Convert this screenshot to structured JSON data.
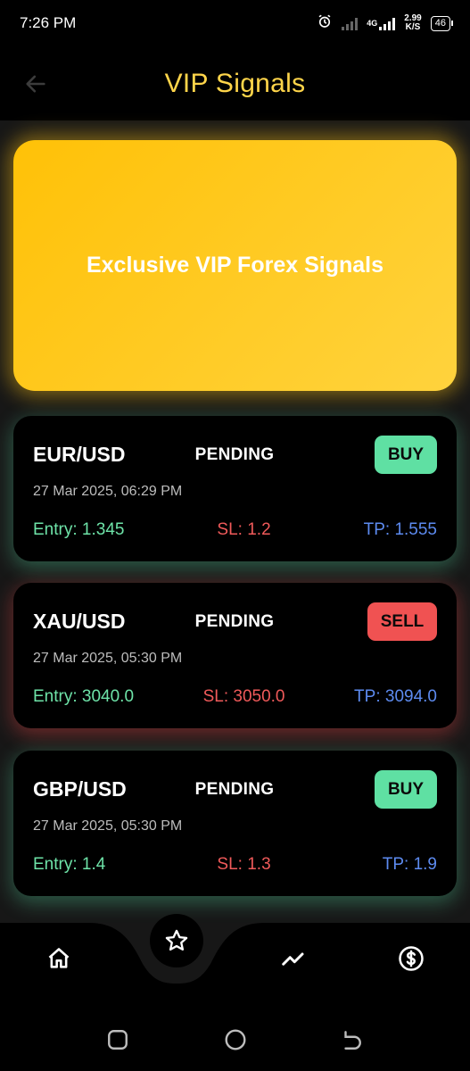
{
  "status_bar": {
    "time": "7:26 PM",
    "network": "4G",
    "speed_value": "2.99",
    "speed_unit": "K/S",
    "battery": "46"
  },
  "app_bar": {
    "title": "VIP Signals",
    "back_icon": "arrow-left-icon"
  },
  "banner": {
    "text": "Exclusive VIP Forex Signals",
    "color": "#ffc107"
  },
  "signals": [
    {
      "pair": "EUR/USD",
      "status": "PENDING",
      "action": "BUY",
      "time": "27 Mar 2025, 06:29 PM",
      "entry": "Entry: 1.345",
      "sl": "SL: 1.2",
      "tp": "TP: 1.555"
    },
    {
      "pair": "XAU/USD",
      "status": "PENDING",
      "action": "SELL",
      "time": "27 Mar 2025, 05:30 PM",
      "entry": "Entry: 3040.0",
      "sl": "SL: 3050.0",
      "tp": "TP: 3094.0"
    },
    {
      "pair": "GBP/USD",
      "status": "PENDING",
      "action": "BUY",
      "time": "27 Mar 2025, 05:30 PM",
      "entry": "Entry: 1.4",
      "sl": "SL: 1.3",
      "tp": "TP: 1.9"
    }
  ],
  "bottom_nav": {
    "items": [
      "home-icon",
      "star-icon",
      "trending-up-icon",
      "dollar-circle-icon"
    ],
    "active": "star-icon"
  },
  "colors": {
    "accent": "#ffd54a",
    "buy": "#5fe0a3",
    "sell": "#f05252",
    "entry": "#6ee3a8",
    "sl": "#f05a5a",
    "tp": "#5d8bf0"
  }
}
